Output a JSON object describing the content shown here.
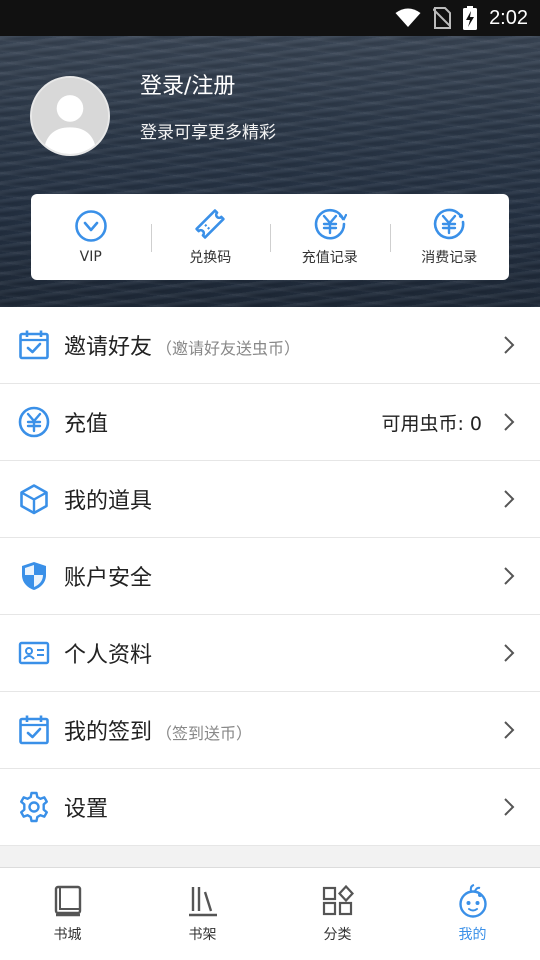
{
  "status_bar": {
    "time": "2:02"
  },
  "profile": {
    "login_title": "登录/注册",
    "login_subtitle": "登录可享更多精彩"
  },
  "quick_actions": [
    {
      "label": "VIP",
      "icon": "vip-icon"
    },
    {
      "label": "兑换码",
      "icon": "ticket-icon"
    },
    {
      "label": "充值记录",
      "icon": "recharge-record-icon"
    },
    {
      "label": "消费记录",
      "icon": "consume-record-icon"
    }
  ],
  "menu": {
    "invite": {
      "title": "邀请好友",
      "hint": "（邀请好友送虫币）",
      "icon": "calendar-check-icon"
    },
    "recharge": {
      "title": "充值",
      "balance_label": "可用虫币:",
      "balance_value": "0",
      "icon": "yen-icon"
    },
    "items": {
      "title": "我的道具",
      "icon": "box-icon"
    },
    "security": {
      "title": "账户安全",
      "icon": "shield-icon"
    },
    "profile": {
      "title": "个人资料",
      "icon": "id-card-icon"
    },
    "checkin": {
      "title": "我的签到",
      "hint": "（签到送币）",
      "icon": "calendar-check-icon"
    },
    "settings": {
      "title": "设置",
      "icon": "gear-icon"
    }
  },
  "tabs": [
    {
      "label": "书城",
      "icon": "book-icon"
    },
    {
      "label": "书架",
      "icon": "bookshelf-icon"
    },
    {
      "label": "分类",
      "icon": "category-icon"
    },
    {
      "label": "我的",
      "icon": "mascot-icon",
      "active": true
    }
  ],
  "colors": {
    "accent": "#3a90e8",
    "text": "#222222",
    "hint": "#888888"
  }
}
